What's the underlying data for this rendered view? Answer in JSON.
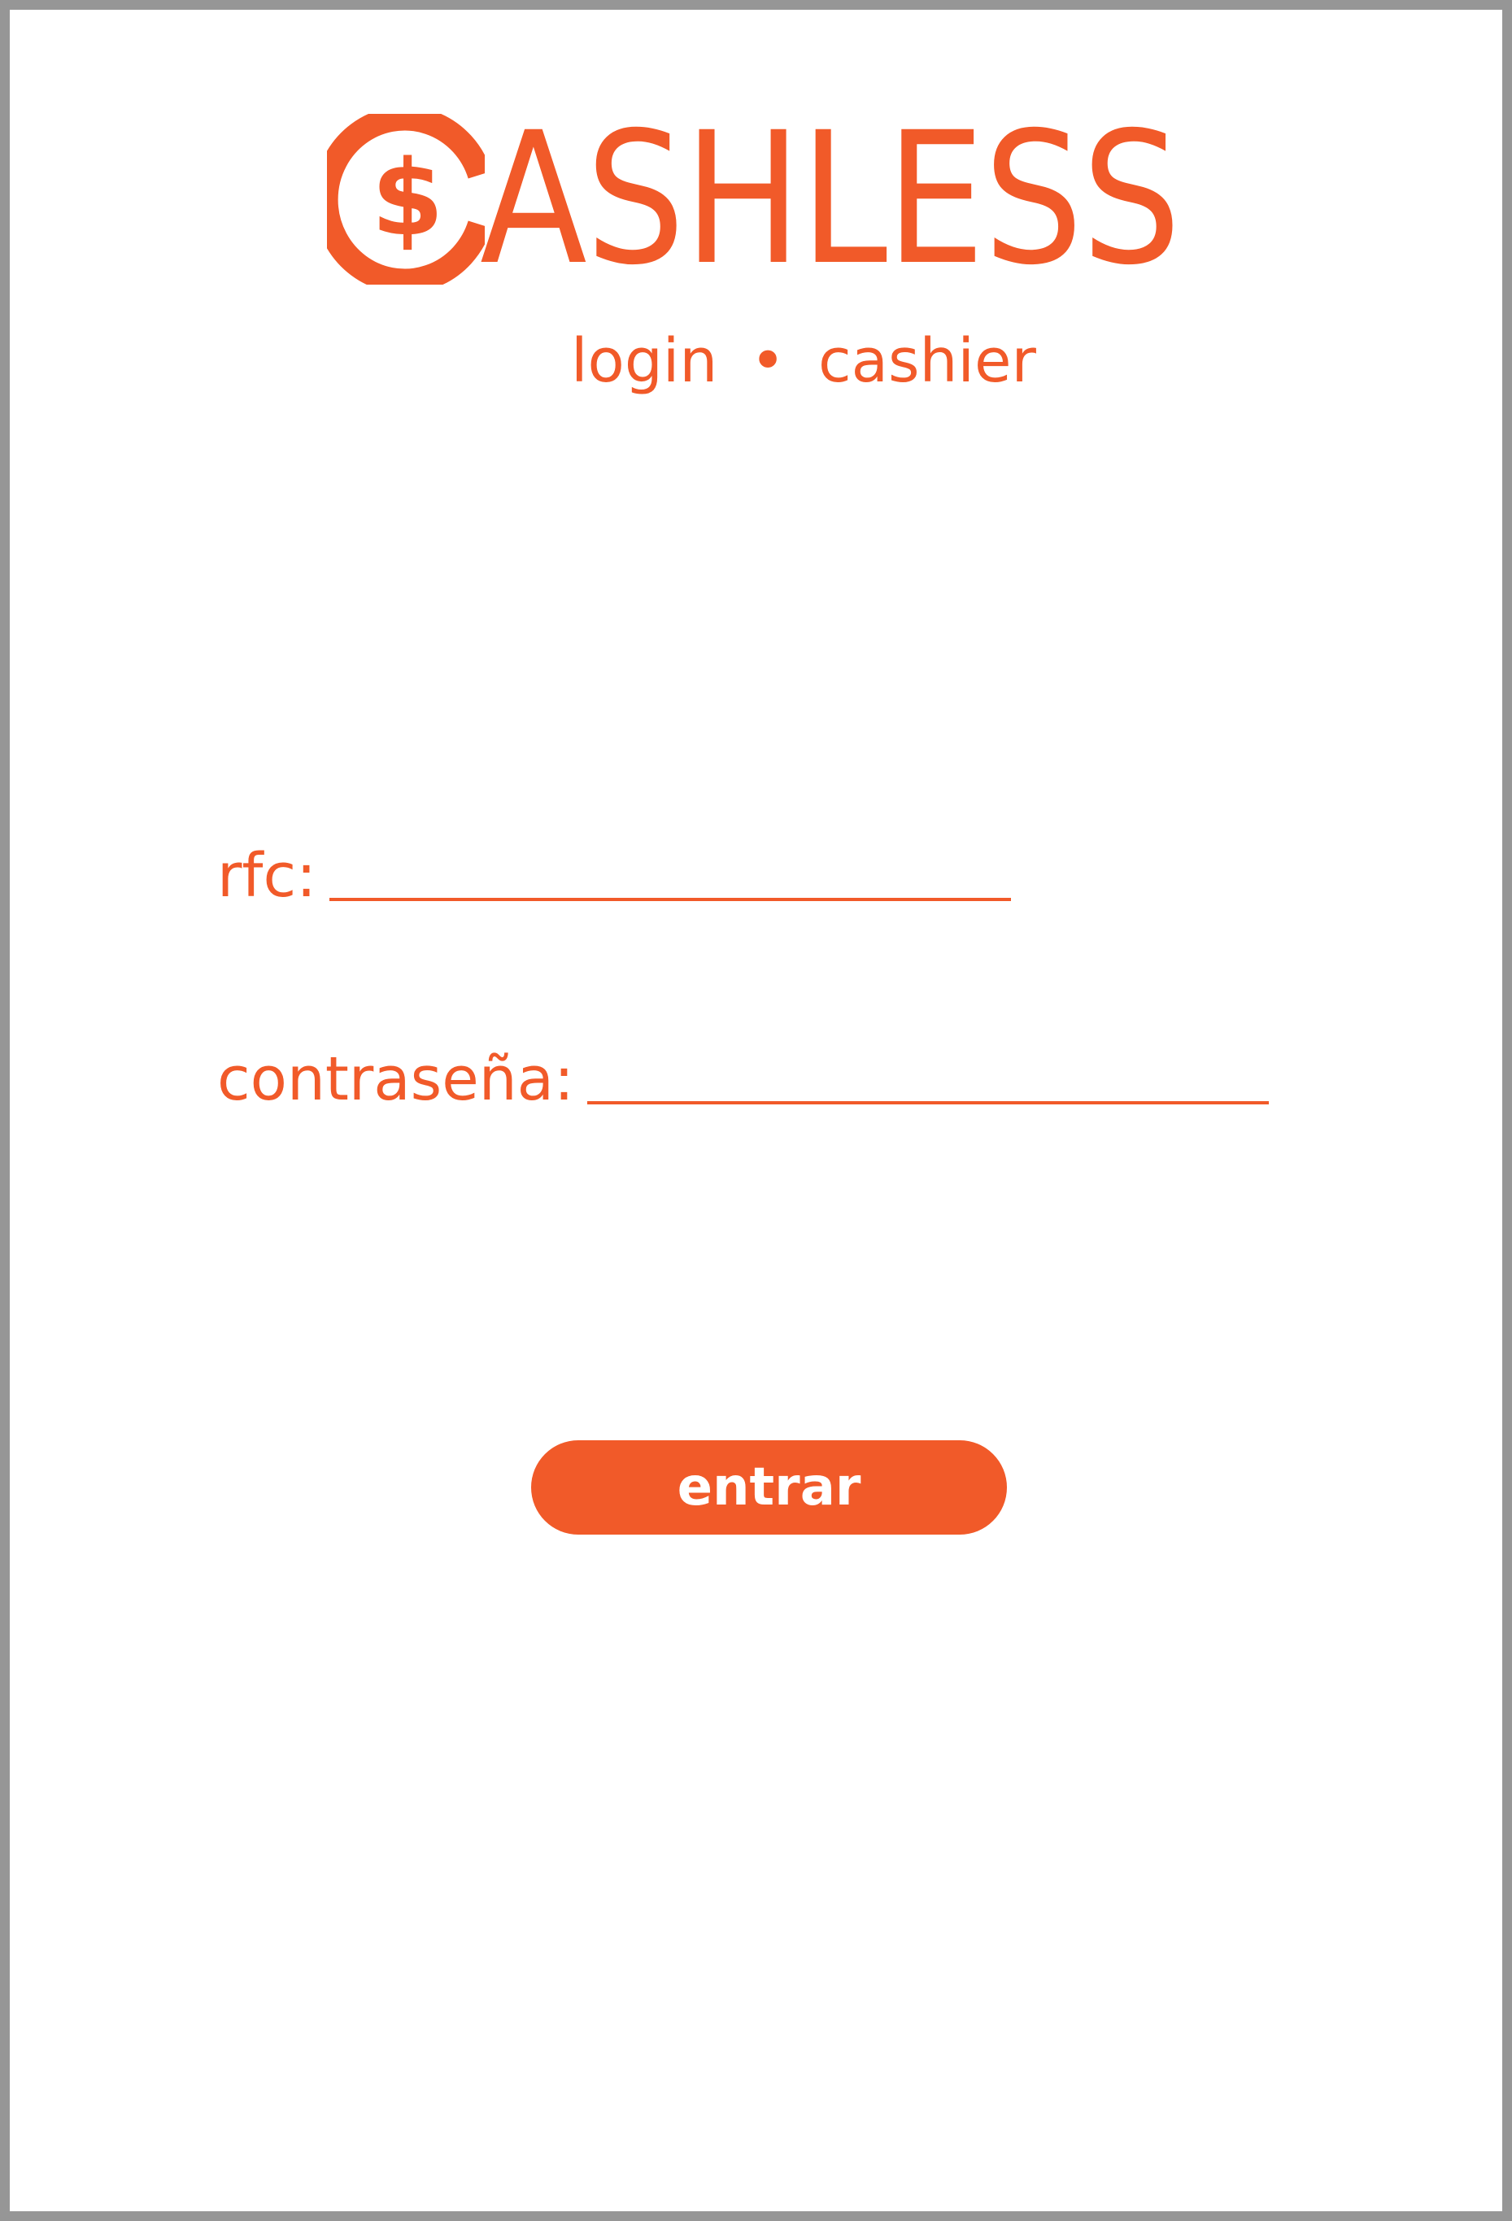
{
  "brand": {
    "name": "ASHLESS",
    "logo_icon": "circle-dollar-c-icon",
    "color": "#f15a29"
  },
  "subtitle": {
    "left": "login",
    "separator": "•",
    "right": "cashier"
  },
  "form": {
    "rfc_label": "rfc:",
    "rfc_value": "",
    "password_label": "contraseña:",
    "password_value": "",
    "submit_label": "entrar"
  },
  "colors": {
    "accent": "#f15a29",
    "frame_border": "#969696",
    "background": "#ffffff",
    "button_text": "#ffffff"
  }
}
